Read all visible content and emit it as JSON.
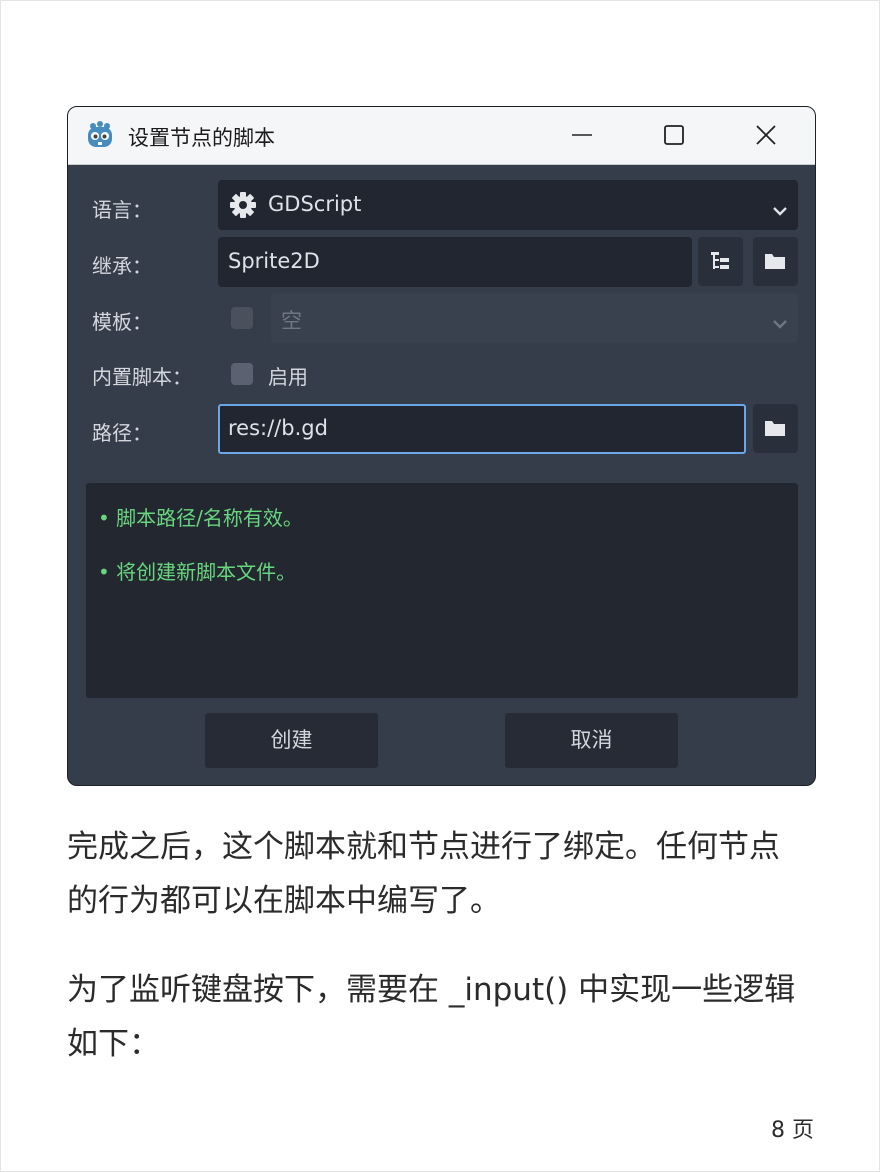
{
  "dialog": {
    "title": "设置节点的脚本",
    "language_label": "语言：",
    "language_value": "GDScript",
    "inherits_label": "继承：",
    "inherits_value": "Sprite2D",
    "template_label": "模板：",
    "template_value": "空",
    "builtin_label": "内置脚本：",
    "builtin_option": "启用",
    "path_label": "路径：",
    "path_value": "res://b.gd",
    "messages": [
      "• 脚本路径/名称有效。",
      "• 将创建新脚本文件。"
    ],
    "create_button": "创建",
    "cancel_button": "取消"
  },
  "content": {
    "paragraph1_line1": "完成之后，这个脚本就和节点进行了绑定。任何节点",
    "paragraph1_line2": "的行为都可以在脚本中编写了。",
    "paragraph2_line1": "为了监听键盘按下，需要在 _input() 中实现一些逻辑",
    "paragraph2_line2": "如下："
  },
  "footer": {
    "page_number": "8 页"
  },
  "colors": {
    "accent_border": "#6ba7e6",
    "success_text": "#67d67e",
    "dialog_bg": "#363d4a"
  }
}
